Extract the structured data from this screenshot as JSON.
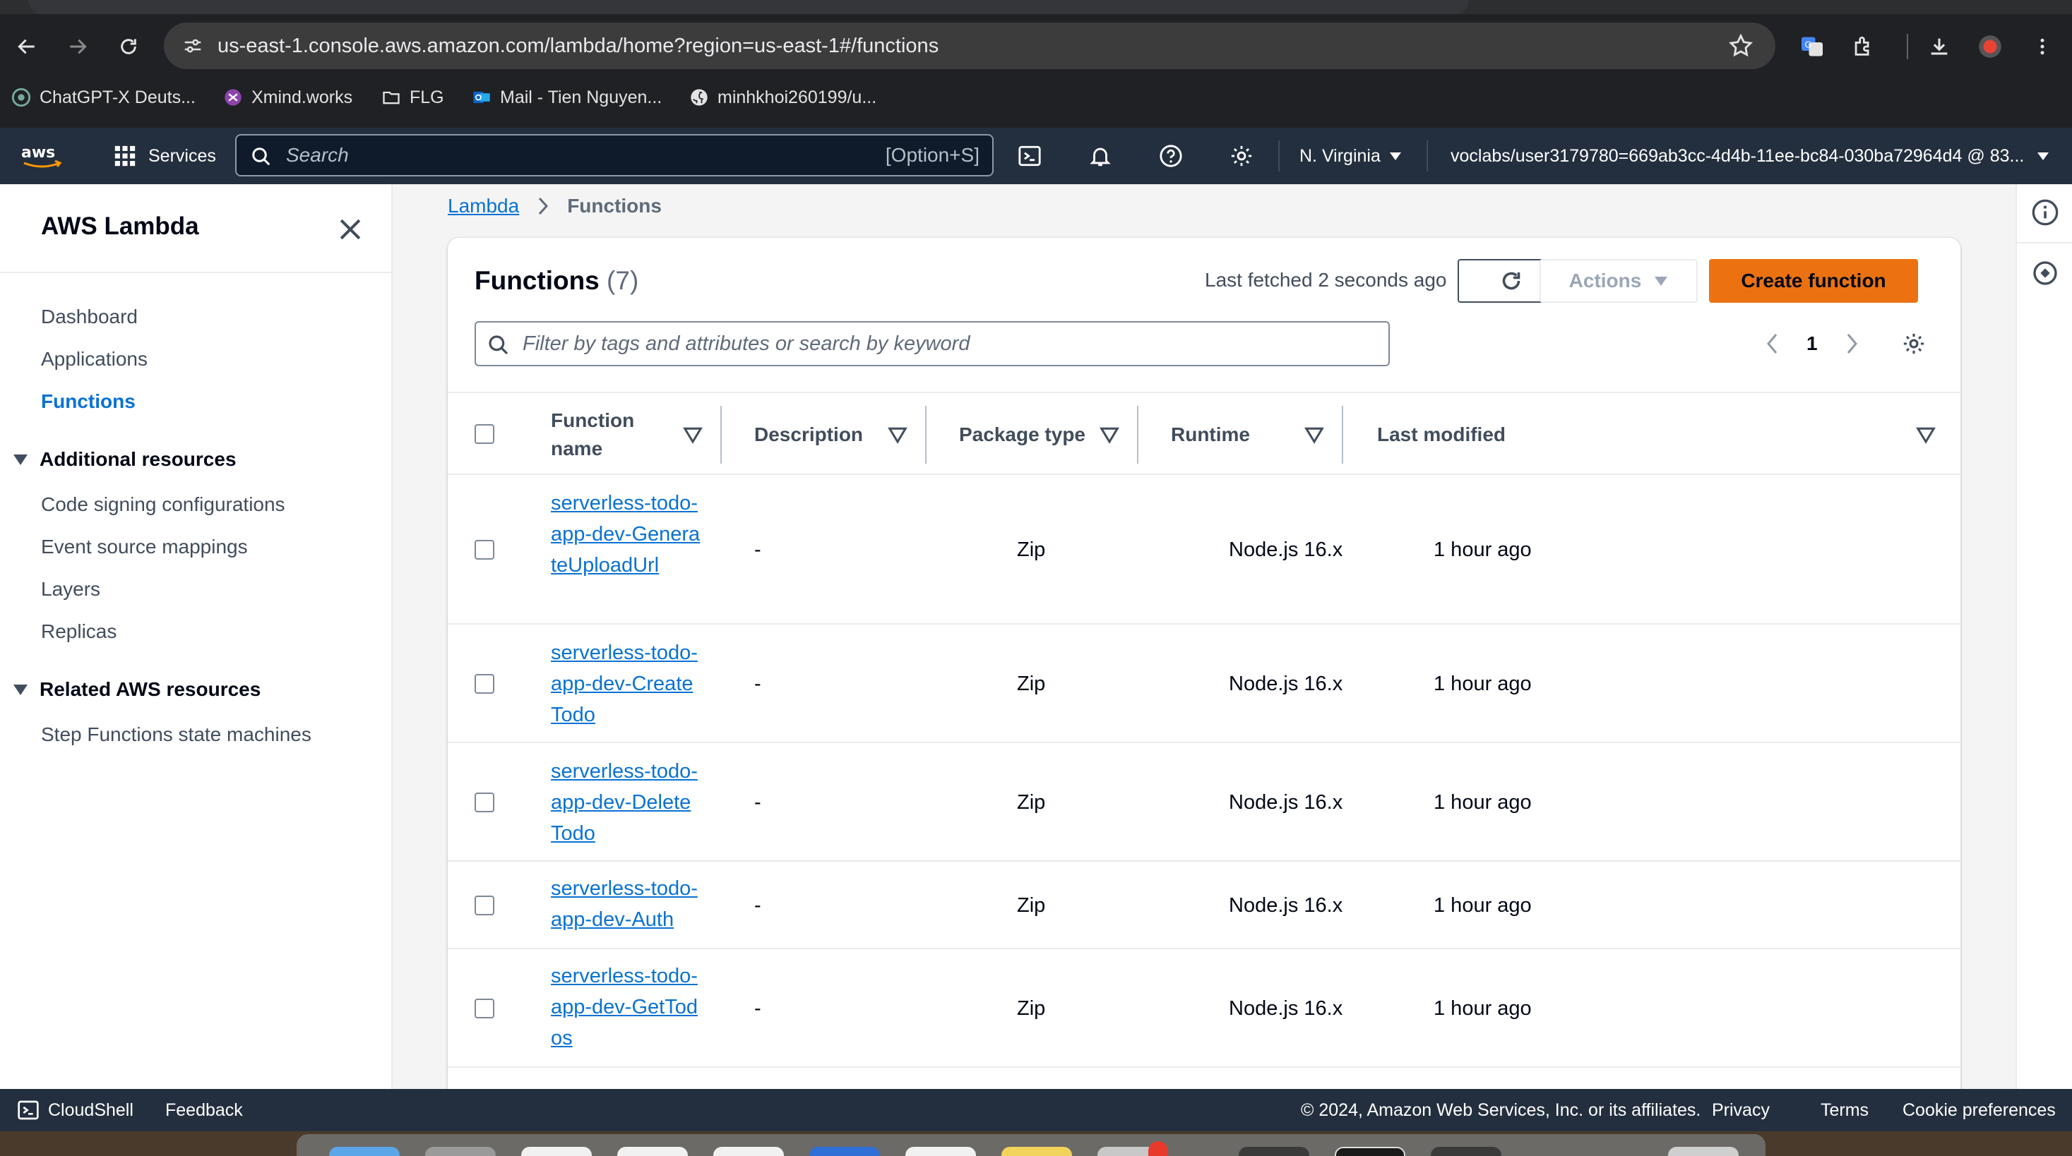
{
  "browser": {
    "url": "us-east-1.console.aws.amazon.com/lambda/home?region=us-east-1#/functions",
    "bookmarks": [
      {
        "label": "ChatGPT-X Deuts...",
        "icon": "chatgpt-icon"
      },
      {
        "label": "Xmind.works",
        "icon": "xmind-icon"
      },
      {
        "label": "FLG",
        "icon": "folder-icon"
      },
      {
        "label": "Mail - Tien Nguyen...",
        "icon": "outlook-icon"
      },
      {
        "label": "minhkhoi260199/u...",
        "icon": "github-icon"
      }
    ]
  },
  "awsnav": {
    "services_label": "Services",
    "search_placeholder": "Search",
    "search_shortcut": "[Option+S]",
    "region": "N. Virginia",
    "account": "voclabs/user3179780=669ab3cc-4d4b-11ee-bc84-030ba72964d4 @ 83..."
  },
  "sidebar": {
    "title": "AWS Lambda",
    "items": [
      {
        "label": "Dashboard"
      },
      {
        "label": "Applications"
      },
      {
        "label": "Functions"
      }
    ],
    "additional_heading": "Additional resources",
    "additional_items": [
      {
        "label": "Code signing configurations"
      },
      {
        "label": "Event source mappings"
      },
      {
        "label": "Layers"
      },
      {
        "label": "Replicas"
      }
    ],
    "related_heading": "Related AWS resources",
    "related_items": [
      {
        "label": "Step Functions state machines"
      }
    ]
  },
  "breadcrumb": {
    "root": "Lambda",
    "current": "Functions"
  },
  "functions": {
    "title": "Functions",
    "count": "(7)",
    "fetched": "Last fetched 2 seconds ago",
    "actions_label": "Actions",
    "create_label": "Create function",
    "filter_placeholder": "Filter by tags and attributes or search by keyword",
    "page": "1",
    "columns": {
      "name_line1": "Function",
      "name_line2": "name",
      "description": "Description",
      "package": "Package type",
      "runtime": "Runtime",
      "modified": "Last modified"
    },
    "rows": [
      {
        "name": "serverless-todo-app-dev-GenerateUploadUrl",
        "description": "-",
        "package": "Zip",
        "runtime": "Node.js 16.x",
        "modified": "1 hour ago"
      },
      {
        "name": "serverless-todo-app-dev-CreateTodo",
        "description": "-",
        "package": "Zip",
        "runtime": "Node.js 16.x",
        "modified": "1 hour ago"
      },
      {
        "name": "serverless-todo-app-dev-DeleteTodo",
        "description": "-",
        "package": "Zip",
        "runtime": "Node.js 16.x",
        "modified": "1 hour ago"
      },
      {
        "name": "serverless-todo-app-dev-Auth",
        "description": "-",
        "package": "Zip",
        "runtime": "Node.js 16.x",
        "modified": "1 hour ago"
      },
      {
        "name": "serverless-todo-app-dev-GetTodos",
        "description": "-",
        "package": "Zip",
        "runtime": "Node.js 16.x",
        "modified": "1 hour ago"
      }
    ]
  },
  "footer": {
    "cloudshell": "CloudShell",
    "feedback": "Feedback",
    "copyright": "© 2024, Amazon Web Services, Inc. or its affiliates.",
    "privacy": "Privacy",
    "terms": "Terms",
    "cookies": "Cookie preferences"
  },
  "colors": {
    "link": "#0972d3",
    "primary_button": "#ec7211",
    "aws_nav": "#232f3e",
    "browser_chrome": "#202124"
  }
}
